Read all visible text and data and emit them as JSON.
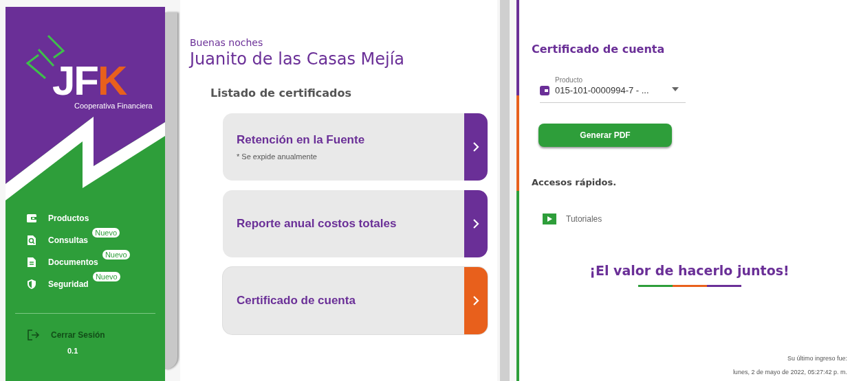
{
  "sidebar": {
    "logo": {
      "letters": "JF",
      "accent_letter": "K",
      "tagline": "Cooperativa Financiera"
    },
    "items": [
      {
        "label": "Productos",
        "kind": "wallet"
      },
      {
        "label": "Consultas",
        "kind": "search",
        "badge": "Nuevo"
      },
      {
        "label": "Documentos",
        "kind": "document",
        "badge": "Nuevo"
      },
      {
        "label": "Seguridad",
        "kind": "security",
        "badge": "Nuevo"
      }
    ],
    "logout": "Cerrar Sesión",
    "version": "0.1"
  },
  "main": {
    "greeting": "Buenas noches",
    "user_name": "Juanito de las Casas Mejía",
    "list_title": "Listado de certificados",
    "certificates": [
      {
        "title": "Retención en la Fuente",
        "note": "* Se expide anualmente",
        "color": "#6a2f97",
        "selected": false
      },
      {
        "title": "Reporte anual costos totales",
        "color": "#6a2f97",
        "selected": false
      },
      {
        "title": "Certificado de cuenta",
        "color": "#e8601c",
        "selected": true
      }
    ]
  },
  "detail": {
    "title": "Certificado de cuenta",
    "product_field": {
      "label": "Producto",
      "value": "015-101-0000994-7 - ..."
    },
    "generate_button": "Generar PDF",
    "quick_title": "Accesos rápidos.",
    "quick_links": [
      {
        "label": "Tutoriales"
      }
    ],
    "slogan": "¡El valor de hacerlo juntos!",
    "last_login_label": "Su último ingreso fue:",
    "last_login_value": "lunes, 2 de mayo de 2022, 05:27:42 p. m."
  }
}
